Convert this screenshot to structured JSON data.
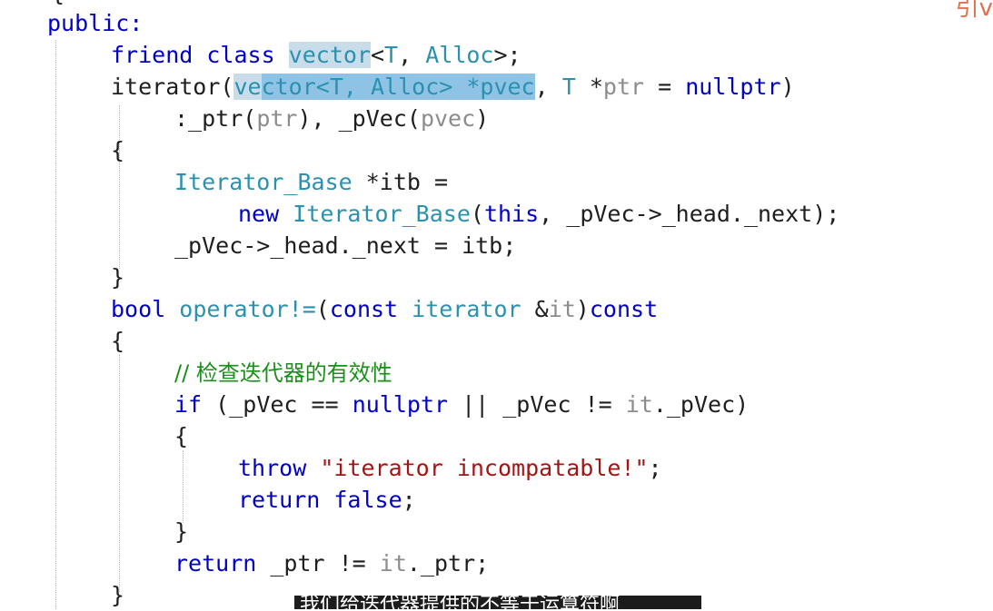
{
  "editor": {
    "top_brace": "{",
    "corner_mark": "引v",
    "lines": [
      {
        "segments": [
          {
            "t": "public:",
            "c": "kw"
          }
        ]
      },
      {
        "segments": [
          {
            "t": "friend class ",
            "c": "kw"
          },
          {
            "t": "vector",
            "c": "ty hl-a"
          },
          {
            "t": "<",
            "c": ""
          },
          {
            "t": "T",
            "c": "ty"
          },
          {
            "t": ", ",
            "c": ""
          },
          {
            "t": "Alloc",
            "c": "ty"
          },
          {
            "t": ">;",
            "c": ""
          }
        ]
      },
      {
        "segments": [
          {
            "t": "iterator(",
            "c": ""
          },
          {
            "t": "ve",
            "c": "ty hl-a"
          },
          {
            "t": "ctor<T, Alloc> *pvec",
            "c": "ty hl-b"
          },
          {
            "t": ", ",
            "c": ""
          },
          {
            "t": "T",
            "c": "ty"
          },
          {
            "t": " *",
            "c": ""
          },
          {
            "t": "ptr",
            "c": "gr"
          },
          {
            "t": " = ",
            "c": ""
          },
          {
            "t": "nullptr",
            "c": "kw"
          },
          {
            "t": ")",
            "c": ""
          }
        ]
      },
      {
        "segments": [
          {
            "t": ":_ptr(",
            "c": ""
          },
          {
            "t": "ptr",
            "c": "gr"
          },
          {
            "t": "), _pVec(",
            "c": ""
          },
          {
            "t": "pvec",
            "c": "gr"
          },
          {
            "t": ")",
            "c": ""
          }
        ]
      },
      {
        "segments": [
          {
            "t": "{",
            "c": ""
          }
        ]
      },
      {
        "segments": [
          {
            "t": "Iterator_Base",
            "c": "ty"
          },
          {
            "t": " *itb =",
            "c": ""
          }
        ]
      },
      {
        "segments": [
          {
            "t": "new ",
            "c": "kw"
          },
          {
            "t": "Iterator_Base",
            "c": "ty"
          },
          {
            "t": "(",
            "c": ""
          },
          {
            "t": "this",
            "c": "kw"
          },
          {
            "t": ", _pVec->_head._next);",
            "c": ""
          }
        ]
      },
      {
        "segments": [
          {
            "t": "_pVec->_head._next = itb;",
            "c": ""
          }
        ]
      },
      {
        "segments": [
          {
            "t": "}",
            "c": ""
          }
        ]
      },
      {
        "segments": [
          {
            "t": "bool ",
            "c": "kw"
          },
          {
            "t": "operator!=",
            "c": "ty"
          },
          {
            "t": "(",
            "c": ""
          },
          {
            "t": "const ",
            "c": "kw"
          },
          {
            "t": "iterator",
            "c": "ty"
          },
          {
            "t": " &",
            "c": ""
          },
          {
            "t": "it",
            "c": "gr"
          },
          {
            "t": ")",
            "c": ""
          },
          {
            "t": "const",
            "c": "kw"
          }
        ]
      },
      {
        "segments": [
          {
            "t": "{",
            "c": ""
          }
        ]
      },
      {
        "segments": [
          {
            "t": "// 检查迭代器的有效性",
            "c": "cm"
          }
        ]
      },
      {
        "segments": [
          {
            "t": "if",
            "c": "kw"
          },
          {
            "t": " (_pVec == ",
            "c": ""
          },
          {
            "t": "nullptr",
            "c": "kw"
          },
          {
            "t": " || _pVec != ",
            "c": ""
          },
          {
            "t": "it",
            "c": "gr"
          },
          {
            "t": "._pVec)",
            "c": ""
          }
        ]
      },
      {
        "segments": [
          {
            "t": "{",
            "c": ""
          }
        ]
      },
      {
        "segments": [
          {
            "t": "throw ",
            "c": "kw"
          },
          {
            "t": "\"iterator incompatable!\"",
            "c": "str"
          },
          {
            "t": ";",
            "c": ""
          }
        ]
      },
      {
        "segments": [
          {
            "t": "return false",
            "c": "kw"
          },
          {
            "t": ";",
            "c": ""
          }
        ]
      },
      {
        "segments": [
          {
            "t": "}",
            "c": ""
          }
        ]
      },
      {
        "segments": [
          {
            "t": "return ",
            "c": "kw"
          },
          {
            "t": "_ptr != ",
            "c": ""
          },
          {
            "t": "it",
            "c": "gr"
          },
          {
            "t": "._ptr;",
            "c": ""
          }
        ]
      },
      {
        "segments": [
          {
            "t": "}",
            "c": ""
          }
        ]
      }
    ]
  },
  "subtitle": "我们给迭代器提供的不等于运算符啊"
}
